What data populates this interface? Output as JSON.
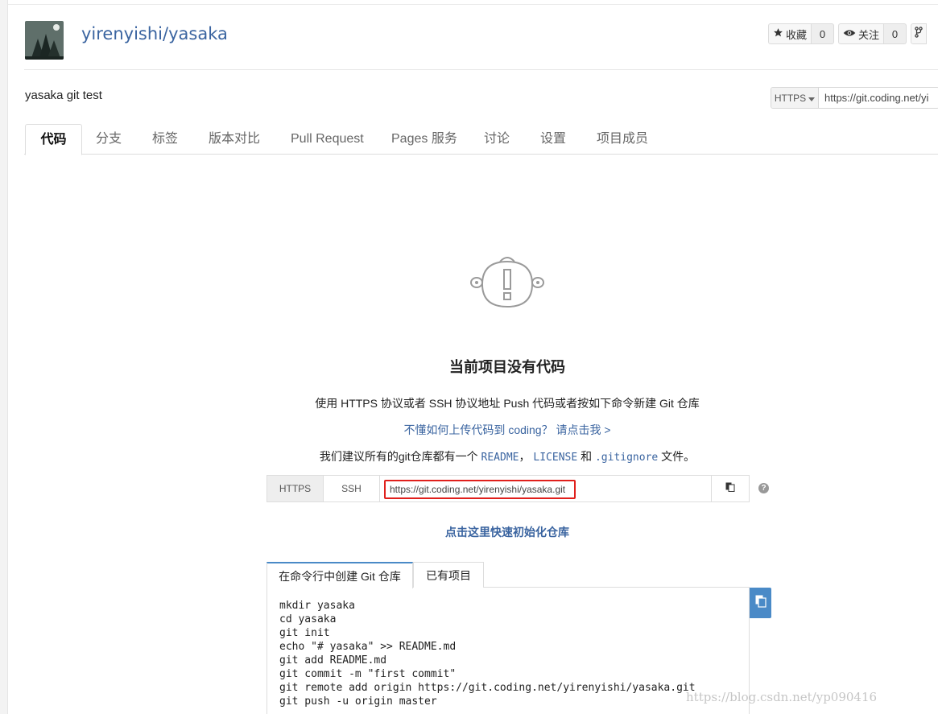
{
  "repo": {
    "title": "yirenyishi/yasaka",
    "description": "yasaka git test"
  },
  "actions": {
    "star_label": "收藏",
    "star_count": "0",
    "watch_label": "关注",
    "watch_count": "0"
  },
  "clone_top": {
    "protocol": "HTTPS",
    "url": "https://git.coding.net/yi"
  },
  "tabs": [
    {
      "label": "代码"
    },
    {
      "label": "分支"
    },
    {
      "label": "标签"
    },
    {
      "label": "版本对比"
    },
    {
      "label": "Pull Request"
    },
    {
      "label": "Pages 服务"
    },
    {
      "label": "讨论"
    },
    {
      "label": "设置"
    },
    {
      "label": "项目成员"
    }
  ],
  "empty": {
    "title": "当前项目没有代码",
    "instruction": "使用 HTTPS 协议或者 SSH 协议地址 Push 代码或者按如下命令新建 Git 仓库",
    "help_link": "不懂如何上传代码到 coding？ 请点击我 >",
    "suggest_prefix": "我们建议所有的git仓库都有一个",
    "file_readme": "README",
    "sep1": "，",
    "file_license": "LICENSE",
    "conj": "和",
    "file_gitignore": ".gitignore",
    "suggest_suffix": "文件。"
  },
  "clone_box": {
    "tab_https": "HTTPS",
    "tab_ssh": "SSH",
    "url": "https://git.coding.net/yirenyishi/yasaka.git",
    "help": "?"
  },
  "init_link": "点击这里快速初始化仓库",
  "cmd_tabs": [
    {
      "label": "在命令行中创建 Git 仓库"
    },
    {
      "label": "已有项目"
    }
  ],
  "commands": "mkdir yasaka\ncd yasaka\ngit init\necho \"# yasaka\" >> README.md\ngit add README.md\ngit commit -m \"first commit\"\ngit remote add origin https://git.coding.net/yirenyishi/yasaka.git\ngit push -u origin master",
  "watermark": "https://blog.csdn.net/yp090416",
  "colors": {
    "link": "#3a64a0",
    "accent": "#4a8ac7",
    "highlight_border": "#e0201c"
  }
}
